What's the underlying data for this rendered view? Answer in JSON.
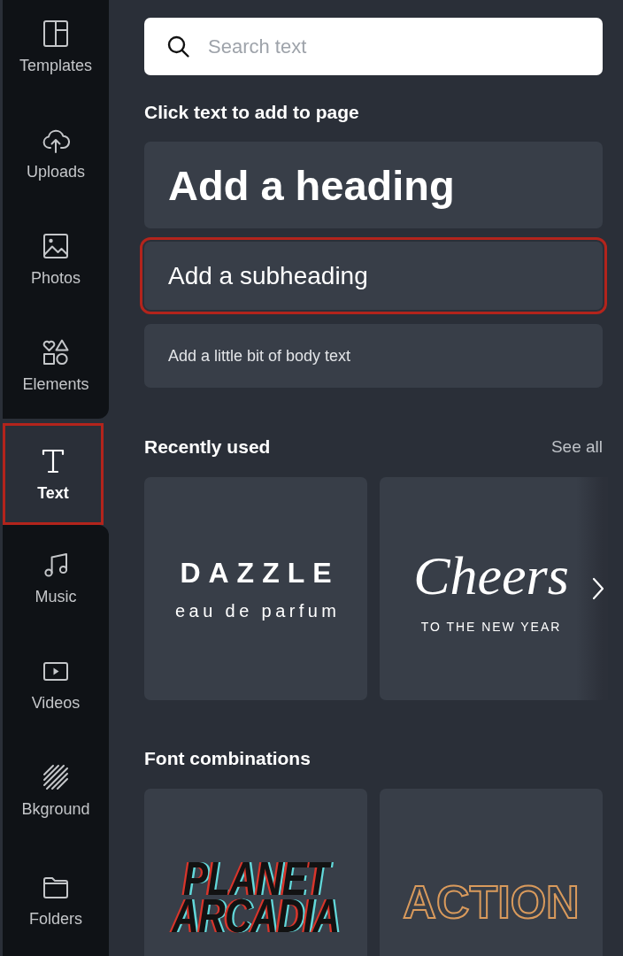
{
  "sidebar": {
    "items": [
      {
        "label": "Templates",
        "selected": false,
        "highlighted": false
      },
      {
        "label": "Uploads",
        "selected": false,
        "highlighted": false
      },
      {
        "label": "Photos",
        "selected": false,
        "highlighted": false
      },
      {
        "label": "Elements",
        "selected": false,
        "highlighted": false
      },
      {
        "label": "Text",
        "selected": true,
        "highlighted": true
      },
      {
        "label": "Music",
        "selected": false,
        "highlighted": false
      },
      {
        "label": "Videos",
        "selected": false,
        "highlighted": false
      },
      {
        "label": "Bkground",
        "selected": false,
        "highlighted": false
      },
      {
        "label": "Folders",
        "selected": false,
        "highlighted": false
      }
    ]
  },
  "search": {
    "placeholder": "Search text"
  },
  "text_styles": {
    "title": "Click text to add to page",
    "items": [
      {
        "kind": "heading",
        "label": "Add a heading",
        "highlighted": false
      },
      {
        "kind": "subheading",
        "label": "Add a subheading",
        "highlighted": true
      },
      {
        "kind": "body",
        "label": "Add a little bit of body text",
        "highlighted": false
      }
    ]
  },
  "recently_used": {
    "title": "Recently used",
    "link": "See all",
    "items": [
      {
        "kind": "spaced",
        "lines": [
          "DAZZLE",
          "eau de parfum"
        ]
      },
      {
        "kind": "script",
        "lines": [
          "Cheers",
          "TO THE NEW YEAR"
        ]
      }
    ]
  },
  "font_combinations": {
    "title": "Font combinations",
    "items": [
      {
        "kind": "glitch",
        "lines": [
          "PLANET",
          "ARCADIA"
        ]
      },
      {
        "kind": "outline",
        "lines": [
          "ACTION"
        ]
      }
    ]
  }
}
